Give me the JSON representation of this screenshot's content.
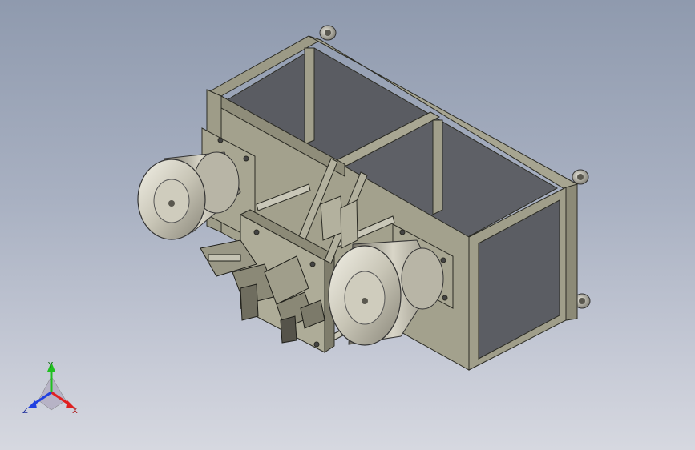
{
  "viewport": {
    "background_top": "#8f9aae",
    "background_bottom": "#d6d8e0",
    "model": "machine-frame-assembly"
  },
  "triad": {
    "x_label": "X",
    "y_label": "Y",
    "z_label": "Z",
    "x_color": "#e02020",
    "y_color": "#20c020",
    "z_color": "#2040e0"
  }
}
